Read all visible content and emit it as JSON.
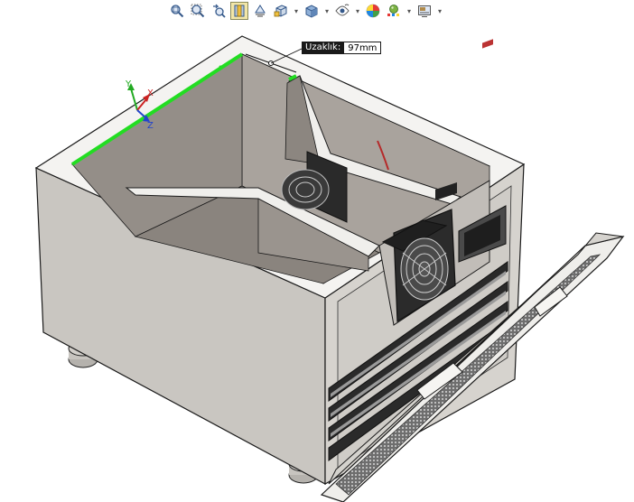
{
  "toolbar": {
    "buttons": [
      {
        "icon": "zoom-to-fit-icon",
        "caret": false
      },
      {
        "icon": "zoom-to-area-icon",
        "caret": false
      },
      {
        "icon": "previous-view-icon",
        "caret": false
      },
      {
        "icon": "section-view-icon",
        "caret": false,
        "active": true
      },
      {
        "icon": "dynamic-annotation-icon",
        "caret": false
      },
      {
        "icon": "view-orientation-icon",
        "caret": true
      },
      {
        "icon": "display-style-icon",
        "caret": true
      },
      {
        "icon": "hide-show-items-icon",
        "caret": true
      },
      {
        "icon": "edit-appearance-icon",
        "caret": false
      },
      {
        "icon": "apply-scene-icon",
        "caret": true
      },
      {
        "icon": "view-settings-icon",
        "caret": true
      }
    ]
  },
  "measure": {
    "label": "Uzaklık:",
    "value": "97mm"
  },
  "triad": {
    "x": "X",
    "y": "Y",
    "z": "Z"
  },
  "colors": {
    "selection": "#22dd22",
    "axis_x": "#cc2222",
    "axis_y": "#22aa22",
    "axis_z": "#2244cc"
  }
}
